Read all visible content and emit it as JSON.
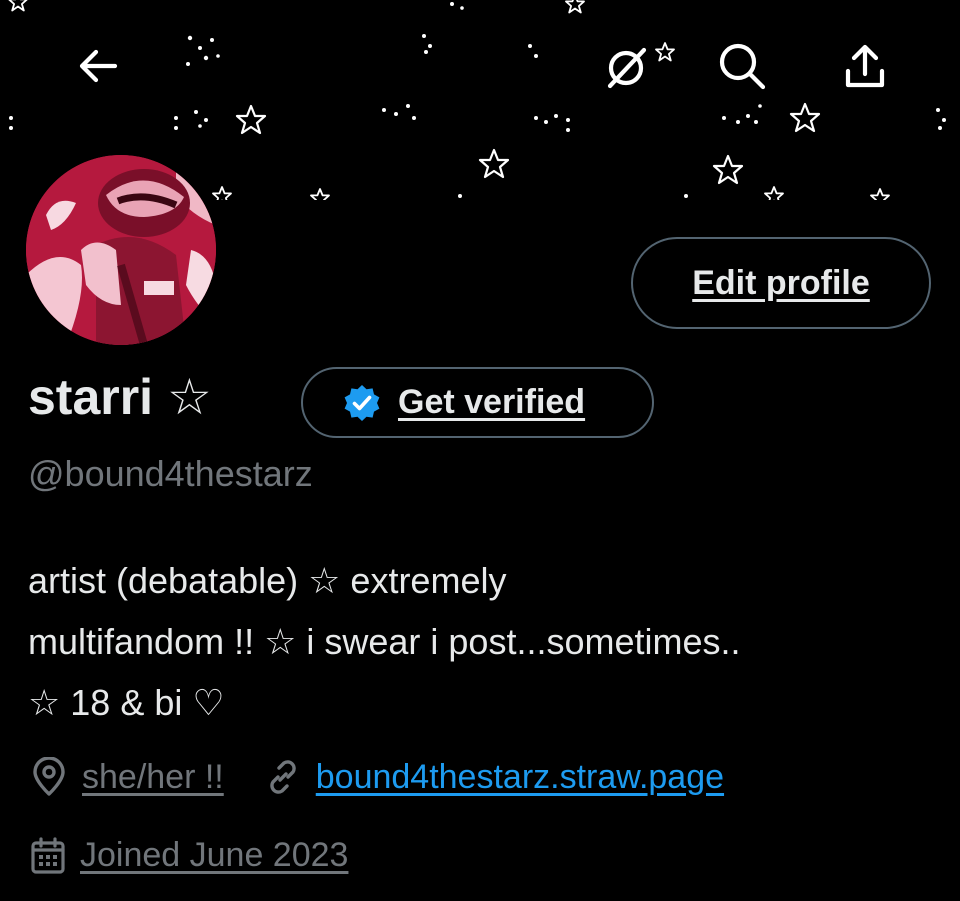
{
  "nav": {
    "back_icon": "arrow-left-icon",
    "hide_icon": "eye-slash-icon",
    "search_icon": "search-icon",
    "share_icon": "share-upload-icon"
  },
  "profile": {
    "display_name": "starri ☆",
    "verify_label": "Get verified",
    "handle": "@bound4thestarz",
    "edit_label": "Edit profile",
    "bio_lines": [
      "artist (debatable) ☆ extremely",
      "multifandom !! ☆ i swear i post...sometimes..",
      "☆ 18 & bi ♡"
    ],
    "location": "she/her !!",
    "website": "bound4thestarz.straw.page",
    "joined": "Joined June 2023"
  },
  "colors": {
    "background": "#000000",
    "primary_text": "#e7e9ea",
    "secondary_text": "#71767b",
    "link": "#1d9bf0",
    "border": "#536471",
    "avatar_accent": "#b5193e"
  }
}
